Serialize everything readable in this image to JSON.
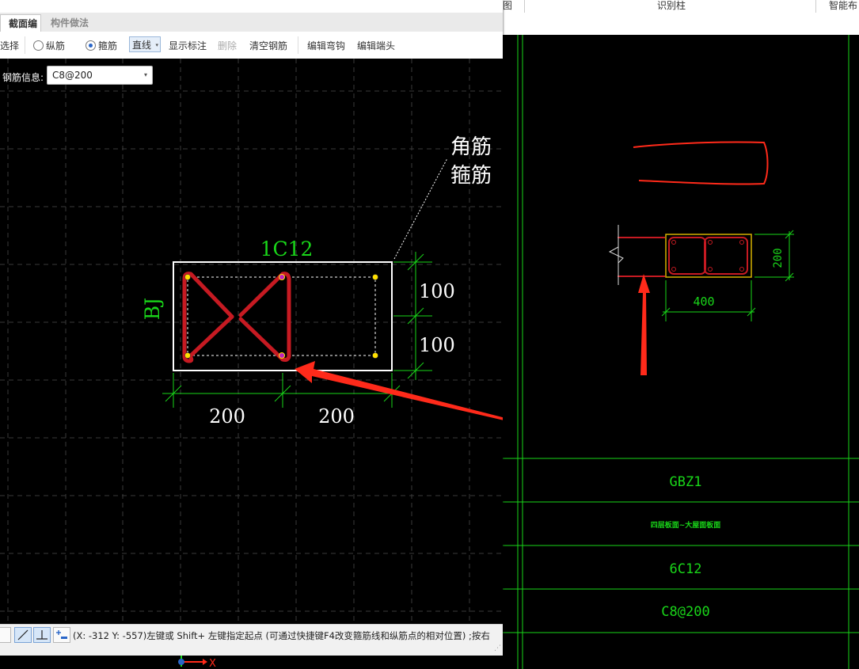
{
  "background_app": {
    "top_menu": {
      "item_left": "图",
      "item_center": "识别柱",
      "item_right": "智能布"
    },
    "drawing": {
      "width_dim": "400",
      "height_dim": "200",
      "table": {
        "rows": [
          "GBZ1",
          "四层板面~大屋面板面",
          "6C12",
          "C8@200"
        ]
      }
    }
  },
  "dialog": {
    "tabs": [
      {
        "label": "截面编辑",
        "active": true
      },
      {
        "label": "构件做法",
        "active": false
      }
    ],
    "toolbar": {
      "select": "选择",
      "longitudinal": "纵筋",
      "stirrup": "箍筋",
      "line_mode": "直线",
      "show_annotation": "显示标注",
      "delete": "删除",
      "clear_rebar": "清空钢筋",
      "edit_hook": "编辑弯钩",
      "edit_end": "编辑端头"
    },
    "rebar_info_label": "钢筋信息:",
    "rebar_info_value": "C8@200",
    "canvas": {
      "annotation_corner": "角筋",
      "annotation_stirrup": "箍筋",
      "top_label": "1C12",
      "left_label": "BJ",
      "dim_right_top": "100",
      "dim_right_bottom": "100",
      "dim_bottom_left": "200",
      "dim_bottom_right": "200"
    },
    "status_text": "(X: -312 Y: -557)左键或 Shift+ 左键指定起点 (可通过快捷键F4改变箍筋线和纵筋点的相对位置) ;按右",
    "axis_label": "X"
  },
  "colors": {
    "cad_green": "#19d619",
    "cad_red": "#c61a22",
    "annotation_red": "#ff2a1a",
    "selection_blue": "#2a66c8"
  }
}
